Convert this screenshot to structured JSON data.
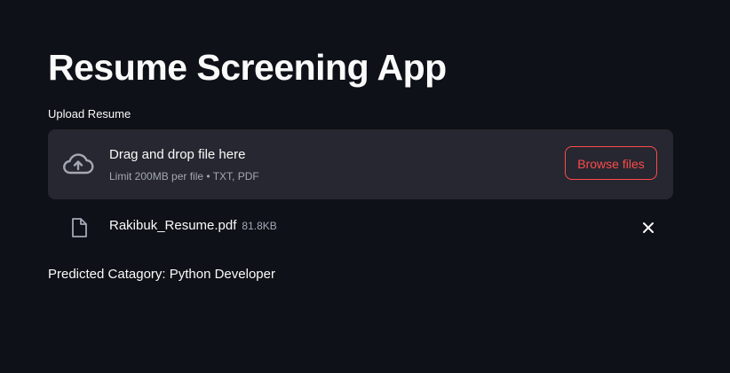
{
  "app": {
    "title": "Resume Screening App"
  },
  "uploader": {
    "label": "Upload Resume",
    "dropzone_title": "Drag and drop file here",
    "dropzone_limit": "Limit 200MB per file • TXT, PDF",
    "browse_label": "Browse files",
    "upload_icon": "cloud-upload-icon"
  },
  "uploaded_file": {
    "name": "Rakibuk_Resume.pdf",
    "size": "81.8KB",
    "file_icon": "file-icon",
    "remove_icon": "close-icon"
  },
  "result": {
    "text": "Predicted Catagory: Python Developer"
  },
  "colors": {
    "background": "#0e1117",
    "dropzone": "#262730",
    "accent": "#ff4b4b",
    "text": "#fafafa",
    "muted": "#a3a8b4"
  }
}
